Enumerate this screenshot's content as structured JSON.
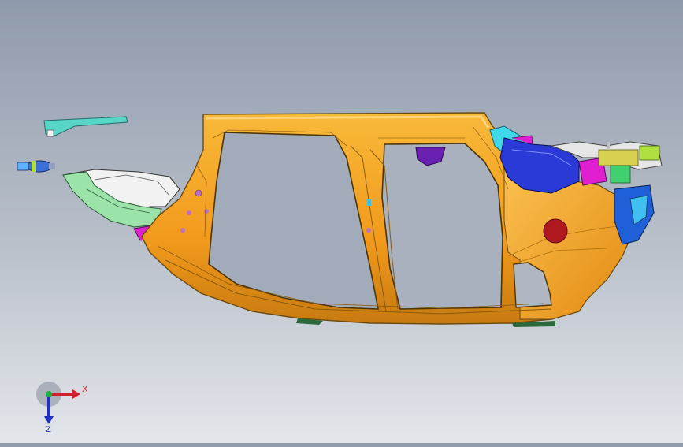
{
  "scene": {
    "background_top": "#8f9aab",
    "background_bottom": "#e3e6ea",
    "body_color": "#f5a623",
    "body_edge_color": "#6b4a10",
    "accent_blue": "#2a3ad6",
    "accent_magenta": "#e020d0",
    "accent_cyan": "#40d8e8",
    "accent_green": "#8fe0a0",
    "accent_red": "#b01820",
    "accent_purple": "#6a20b0"
  },
  "triad": {
    "x_label": "X",
    "z_label": "Z",
    "x_color": "#d0202a",
    "y_color": "#20b040",
    "z_color": "#2030c0"
  }
}
